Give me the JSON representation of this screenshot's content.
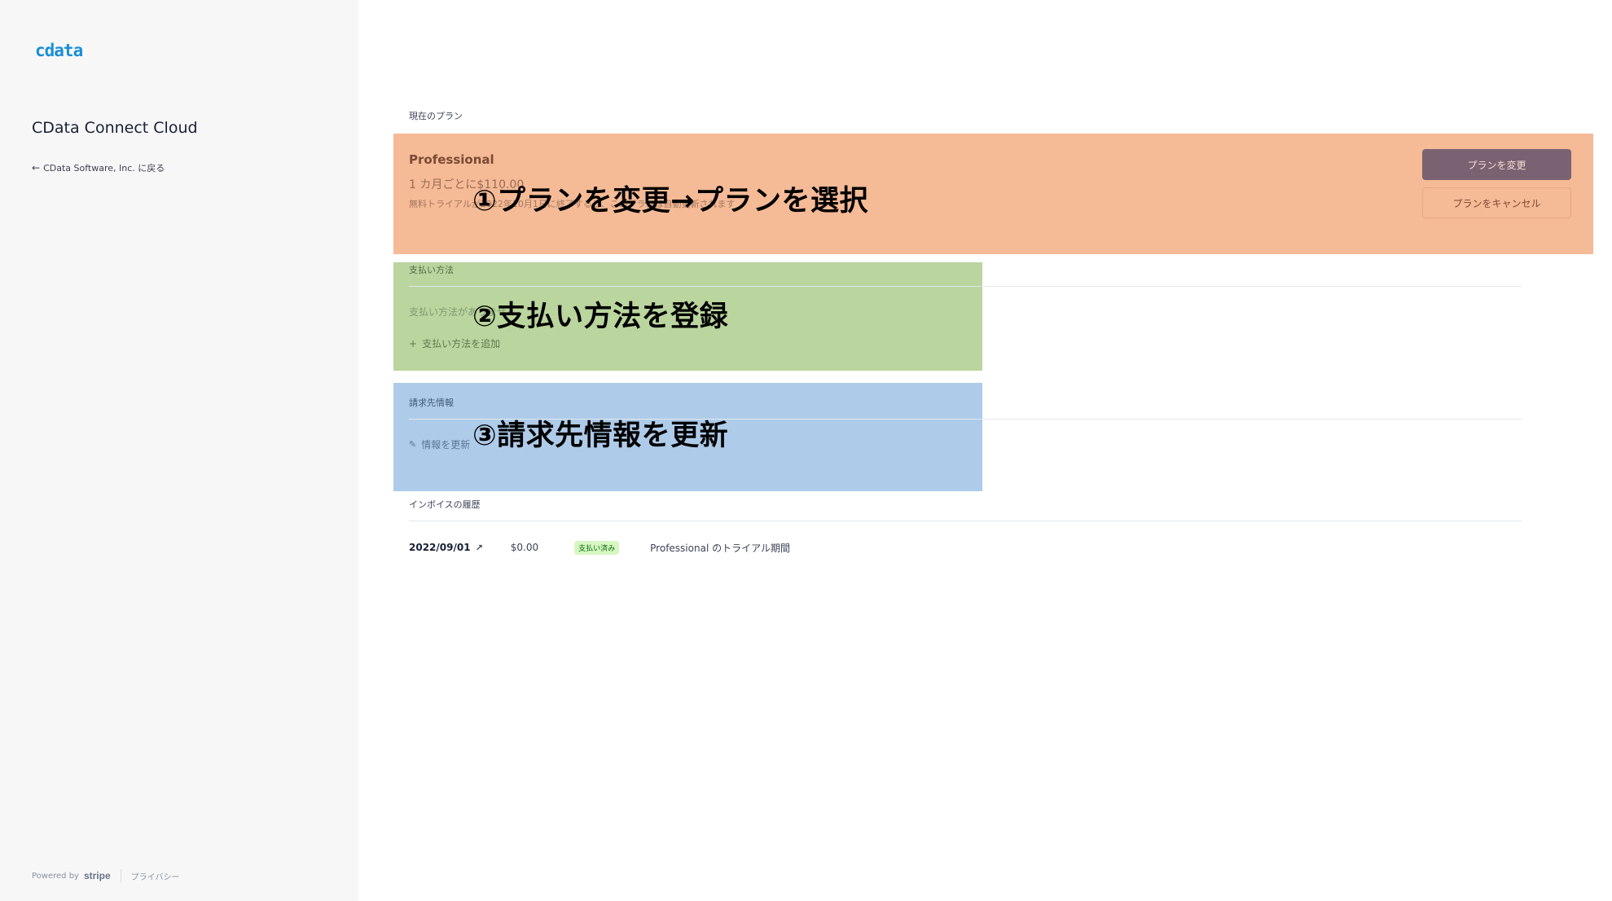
{
  "sidebar": {
    "logo_text": "cdata",
    "app_title": "CData Connect Cloud",
    "back_link": "CData Software, Inc. に戻る",
    "footer": {
      "powered_by": "Powered by",
      "stripe": "stripe",
      "privacy": "プライバシー"
    }
  },
  "current_plan": {
    "section_label": "現在のプラン",
    "plan_name": "Professional",
    "price": "1 カ月ごとに$110.00",
    "note": "無料トライアルが2022年10月1日に終了すると、このプランは自動更新されます",
    "change_button": "プランを変更",
    "cancel_button": "プランをキャンセル"
  },
  "payment_method": {
    "section_label": "支払い方法",
    "empty_text": "支払い方法がありません",
    "add_label": "支払い方法を追加"
  },
  "billing_info": {
    "section_label": "請求先情報",
    "update_label": "情報を更新"
  },
  "invoices": {
    "section_label": "インボイスの履歴",
    "rows": [
      {
        "date": "2022/09/01",
        "amount": "$0.00",
        "status": "支払い済み",
        "description": "Professional のトライアル期間"
      }
    ]
  },
  "annotations": {
    "step1": "①プランを変更→プランを選択",
    "step2": "②支払い方法を登録",
    "step3": "③請求先情報を更新"
  },
  "colors": {
    "step1_band": "#f5ba96",
    "step2_band": "#bad59d",
    "step3_band": "#aecbe9",
    "logo": "#1a8fd6",
    "paid_badge_bg": "#d7f7c2",
    "paid_badge_text": "#05690d"
  }
}
